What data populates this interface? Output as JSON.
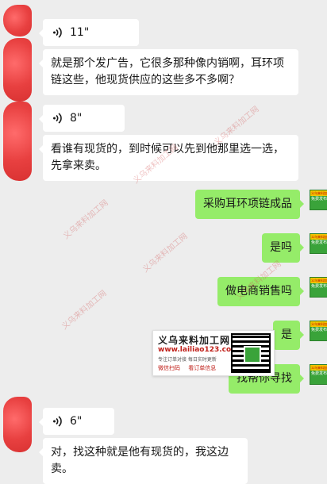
{
  "messages": [
    {
      "side": "left",
      "type": "voice",
      "duration": "11\""
    },
    {
      "side": "left",
      "type": "text",
      "text": "就是那个发广告，它很多那种像内销啊，耳环项链这些，他现货供应的这些多不多啊？"
    },
    {
      "side": "left",
      "type": "voice",
      "duration": "8\""
    },
    {
      "side": "left",
      "type": "text",
      "text": "看谁有现货的，到时候可以先到他那里选一选，先拿来卖。"
    },
    {
      "side": "right",
      "type": "text",
      "text": "采购耳环项链成品"
    },
    {
      "side": "right",
      "type": "text",
      "text": "是吗"
    },
    {
      "side": "right",
      "type": "text",
      "text": "做电商销售吗"
    },
    {
      "side": "right",
      "type": "text",
      "text": "是"
    },
    {
      "side": "right",
      "type": "text",
      "text": "找帮你寻找"
    },
    {
      "side": "left",
      "type": "voice",
      "duration": "6\""
    },
    {
      "side": "left",
      "type": "text",
      "text": "对，找这种就是他有现货的，我这边卖。"
    }
  ],
  "right_avatar": {
    "top_text": "义乌来料加工网",
    "bottom_text": "免费发布"
  },
  "watermark": "义乌来料加工网",
  "ad": {
    "title": "义乌来料加工网",
    "url": "www.lailiao123.com",
    "tagline": "专注订单对接  每日实时更新",
    "link1": "微信扫码",
    "link2": "看订单信息"
  },
  "colors": {
    "background": "#ededed",
    "left_bubble": "#ffffff",
    "right_bubble": "#95ec69"
  }
}
